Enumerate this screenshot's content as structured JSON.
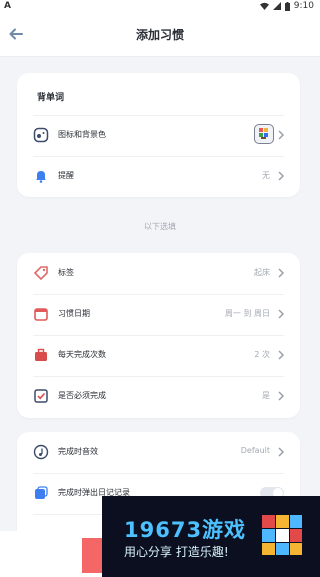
{
  "status": {
    "time": "9:10"
  },
  "header": {
    "title": "添加习惯"
  },
  "section1": {
    "title": "背单词",
    "items": [
      {
        "label": "图标和背景色",
        "value": ""
      },
      {
        "label": "提醒",
        "value": "无"
      }
    ]
  },
  "divider_text": "以下选填",
  "section2": {
    "items": [
      {
        "label": "标签",
        "value": "起床"
      },
      {
        "label": "习惯日期",
        "value": "周一 到 周日"
      },
      {
        "label": "每天完成次数",
        "value": "2 次"
      },
      {
        "label": "是否必须完成",
        "value": "是"
      }
    ]
  },
  "section3": {
    "items": [
      {
        "label": "完成时音效",
        "value": "Default"
      },
      {
        "label": "完成时弹出日记记录",
        "value": ""
      }
    ]
  },
  "overlay": {
    "brand": "19673游戏",
    "slogan": "用心分享 打造乐趣!"
  }
}
